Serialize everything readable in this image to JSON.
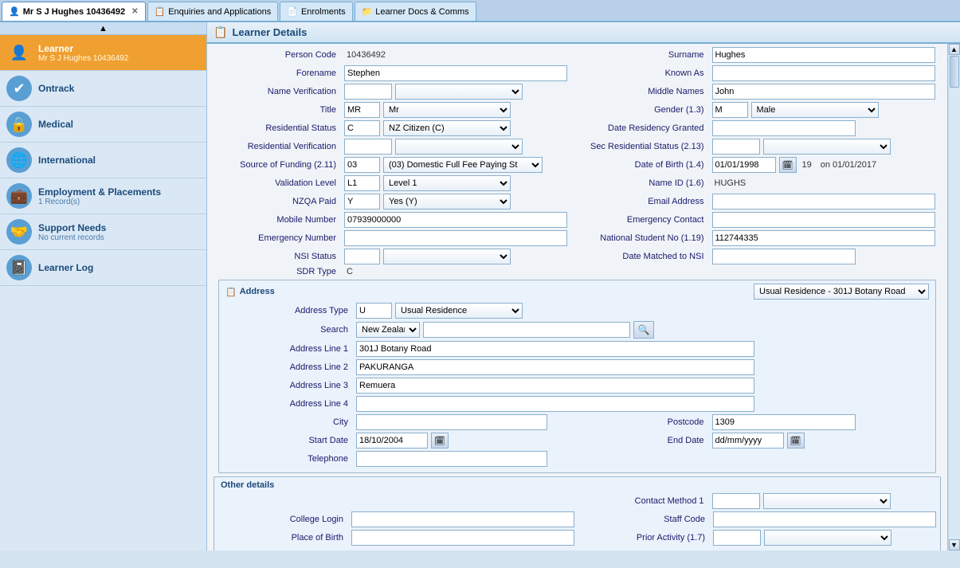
{
  "titlebar": {
    "icon": "👤",
    "title": "Mr S J Hughes 10436492"
  },
  "tabs": [
    {
      "id": "learner",
      "label": "Mr S J Hughes 10436492",
      "icon": "👤",
      "active": true,
      "closable": true
    },
    {
      "id": "enquiries",
      "label": "Enquiries and Applications",
      "icon": "📋",
      "active": false,
      "closable": false
    },
    {
      "id": "enrolments",
      "label": "Enrolments",
      "icon": "📄",
      "active": false,
      "closable": false
    },
    {
      "id": "docs",
      "label": "Learner Docs & Comms",
      "icon": "📁",
      "active": false,
      "closable": false
    }
  ],
  "sidebar": {
    "scroll_up": "▲",
    "items": [
      {
        "id": "learner",
        "label": "Learner",
        "sublabel": "Mr S J Hughes 10436492",
        "icon": "👤",
        "active": true
      },
      {
        "id": "ontrack",
        "label": "Ontrack",
        "sublabel": "",
        "icon": "✅",
        "active": false
      },
      {
        "id": "medical",
        "label": "Medical",
        "sublabel": "",
        "icon": "🩺",
        "active": false
      },
      {
        "id": "international",
        "label": "International",
        "sublabel": "",
        "icon": "🌐",
        "active": false
      },
      {
        "id": "employment",
        "label": "Employment & Placements",
        "sublabel": "1 Record(s)",
        "icon": "💼",
        "active": false
      },
      {
        "id": "support",
        "label": "Support Needs",
        "sublabel": "No current records",
        "icon": "🤝",
        "active": false
      },
      {
        "id": "log",
        "label": "Learner Log",
        "sublabel": "",
        "icon": "📓",
        "active": false
      }
    ]
  },
  "section_header": "Learner Details",
  "form": {
    "person_code_label": "Person Code",
    "person_code_value": "10436492",
    "surname_label": "Surname",
    "surname_value": "Hughes",
    "forename_label": "Forename",
    "forename_value": "Stephen",
    "known_as_label": "Known As",
    "known_as_value": "",
    "name_verification_label": "Name Verification",
    "name_verification_value": "",
    "middle_names_label": "Middle Names",
    "middle_names_value": "John",
    "title_label": "Title",
    "title_short_value": "MR",
    "title_long_value": "Mr",
    "gender_label": "Gender (1.3)",
    "gender_code_value": "M",
    "gender_long_value": "Male",
    "residential_status_label": "Residential Status",
    "residential_status_code": "C",
    "residential_status_long": "NZ Citizen (C)",
    "date_residency_granted_label": "Date Residency Granted",
    "date_residency_granted_value": "",
    "residential_verification_label": "Residential Verification",
    "residential_verification_value": "",
    "sec_residential_label": "Sec Residential Status (2.13)",
    "sec_residential_value": "",
    "source_funding_label": "Source of Funding (2.11)",
    "source_funding_code": "03",
    "source_funding_long": "(03) Domestic Full Fee Paying St",
    "dob_label": "Date of Birth (1.4)",
    "dob_value": "01/01/1998",
    "dob_age": "19",
    "dob_on_date": "on 01/01/2017",
    "validation_level_label": "Validation Level",
    "validation_code": "L1",
    "validation_long": "Level 1",
    "name_id_label": "Name ID (1.6)",
    "name_id_value": "HUGHS",
    "nzqa_paid_label": "NZQA Paid",
    "nzqa_code": "Y",
    "nzqa_long": "Yes (Y)",
    "email_label": "Email Address",
    "email_value": "",
    "mobile_label": "Mobile Number",
    "mobile_value": "07939000000",
    "emergency_contact_label": "Emergency Contact",
    "emergency_contact_value": "",
    "emergency_number_label": "Emergency Number",
    "emergency_number_value": "",
    "national_student_label": "National Student No (1.19)",
    "national_student_value": "112744335",
    "nsi_status_label": "NSI Status",
    "nsi_status_code": "",
    "nsi_status_long": "",
    "date_matched_label": "Date Matched to NSI",
    "date_matched_value": "",
    "sdr_type_label": "SDR Type",
    "sdr_type_value": "C",
    "address_section_title": "Address",
    "address_type_label": "Address Type",
    "address_type_code": "U",
    "address_type_long": "Usual Residence",
    "address_usual_label": "Usual Residence - 301J Botany Road",
    "address_search_label": "Search",
    "address_search_country": "New Zealand",
    "address_line1_label": "Address Line 1",
    "address_line1_value": "301J Botany Road",
    "address_line2_label": "Address Line 2",
    "address_line2_value": "PAKURANGA",
    "address_line3_label": "Address Line 3",
    "address_line3_value": "Remuera",
    "address_line4_label": "Address Line 4",
    "address_line4_value": "",
    "city_label": "City",
    "city_value": "",
    "postcode_label": "Postcode",
    "postcode_value": "1309",
    "start_date_label": "Start Date",
    "start_date_value": "18/10/2004",
    "end_date_label": "End Date",
    "end_date_value": "dd/mm/yyyy",
    "telephone_label": "Telephone",
    "telephone_value": "",
    "other_details_title": "Other details",
    "contact_method_label": "Contact Method 1",
    "contact_method_value": "",
    "college_login_label": "College Login",
    "college_login_value": "",
    "staff_code_label": "Staff Code",
    "staff_code_value": "",
    "place_of_birth_label": "Place of Birth",
    "place_of_birth_value": "",
    "prior_activity_label": "Prior Activity (1.7)",
    "prior_activity_value": ""
  }
}
